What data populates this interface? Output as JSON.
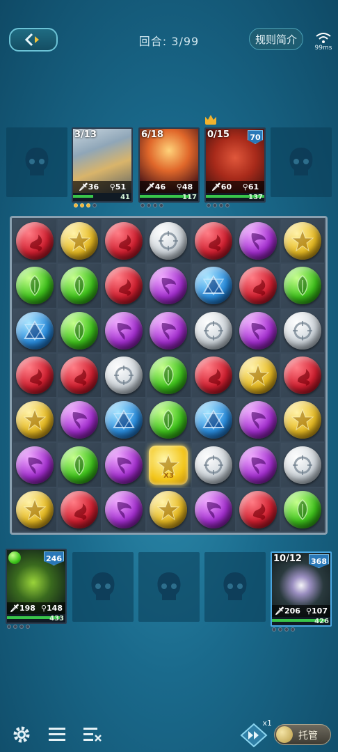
{
  "header": {
    "round_text": "回合: 3/99",
    "rules_label": "规则简介",
    "latency": "99ms"
  },
  "enemies": [
    {
      "count": "3/13",
      "atk": "36",
      "skill": "51",
      "hp": "41",
      "hp_fraction": 0.35,
      "dots": [
        true,
        true,
        true,
        false
      ],
      "art": "blonde-warrior-portrait"
    },
    {
      "count": "6/18",
      "atk": "46",
      "skill": "48",
      "hp": "117",
      "hp_fraction": 0.85,
      "dots": [
        false,
        false,
        false,
        false
      ],
      "art": "fire-warrior-portrait"
    },
    {
      "count": "0/15",
      "atk": "60",
      "skill": "61",
      "hp": "137",
      "hp_fraction": 1.0,
      "badge": "70",
      "dots": [
        false,
        false,
        false,
        false
      ],
      "art": "red-demon-portrait",
      "crown": true
    }
  ],
  "board": [
    [
      "red",
      "yellow",
      "red",
      "white",
      "red",
      "purple",
      "yellow"
    ],
    [
      "green",
      "green",
      "red",
      "purple",
      "blue",
      "red",
      "green"
    ],
    [
      "blue",
      "green",
      "purple",
      "purple",
      "white",
      "purple",
      "white"
    ],
    [
      "red",
      "red",
      "white",
      "green",
      "red",
      "yellow",
      "red"
    ],
    [
      "yellow",
      "purple",
      "blue",
      "green",
      "blue",
      "purple",
      "yellow"
    ],
    [
      "purple",
      "green",
      "purple",
      "special",
      "white",
      "purple",
      "white"
    ],
    [
      "yellow",
      "red",
      "purple",
      "yellow",
      "purple",
      "red",
      "green"
    ]
  ],
  "special_orb_label": "X3",
  "allies": [
    {
      "badge": "246",
      "atk": "198",
      "skill": "148",
      "hp": "433",
      "hp_fraction": 0.9,
      "dots": [
        false,
        false,
        false,
        false
      ],
      "art": "green-beast-portrait"
    },
    {
      "count": "10/12",
      "badge": "368",
      "atk": "206",
      "skill": "107",
      "hp": "426",
      "hp_fraction": 0.9,
      "dots": [
        false,
        false,
        false,
        false
      ],
      "art": "white-flower-portrait"
    }
  ],
  "bottom": {
    "speed_label": "x1",
    "auto_label": "托管"
  }
}
